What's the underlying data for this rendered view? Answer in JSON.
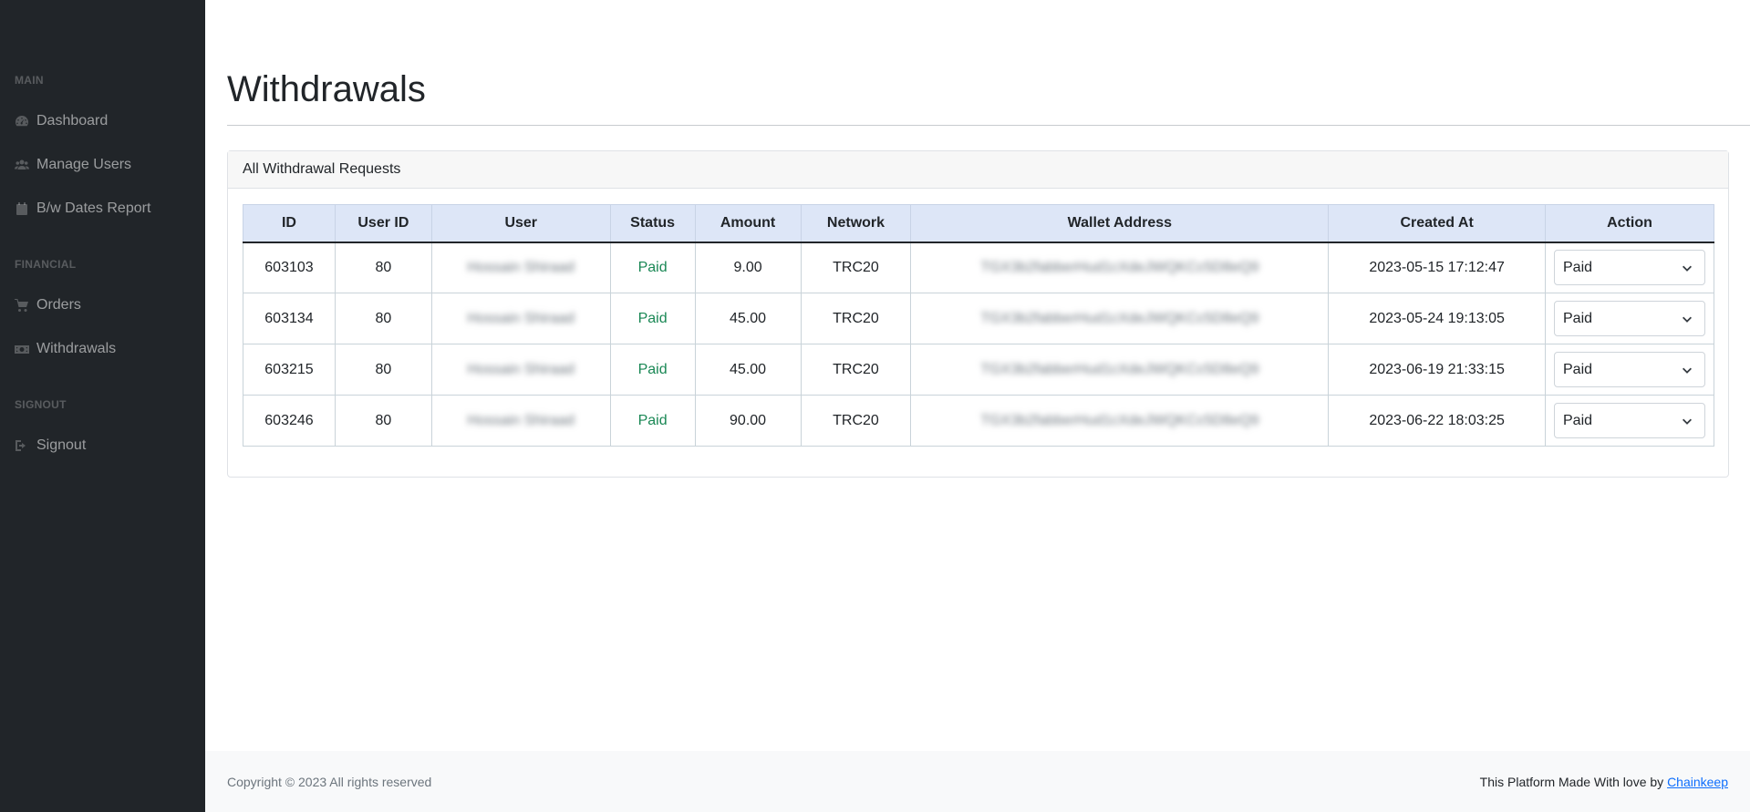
{
  "sidebar": {
    "headings": {
      "main": "MAIN",
      "financial": "FINANCIAL",
      "signout": "SIGNOUT"
    },
    "items": [
      {
        "label": "Dashboard",
        "icon": "tachometer-icon"
      },
      {
        "label": "Manage Users",
        "icon": "users-icon"
      },
      {
        "label": "B/w Dates Report",
        "icon": "calendar-icon"
      },
      {
        "label": "Orders",
        "icon": "cart-icon"
      },
      {
        "label": "Withdrawals",
        "icon": "money-icon"
      },
      {
        "label": "Signout",
        "icon": "sign-out-icon"
      }
    ]
  },
  "page": {
    "title": "Withdrawals"
  },
  "card": {
    "header": "All Withdrawal Requests"
  },
  "table": {
    "columns": [
      "ID",
      "User ID",
      "User",
      "Status",
      "Amount",
      "Network",
      "Wallet Address",
      "Created At",
      "Action"
    ],
    "rows": [
      {
        "id": "603103",
        "user_id": "80",
        "user": "Hossain Shiraad",
        "status": "Paid",
        "amount": "9.00",
        "network": "TRC20",
        "wallet": "TGX3b2fabberHud1cXdeJWQKCc5D8eQ9",
        "created_at": "2023-05-15 17:12:47",
        "action": "Paid"
      },
      {
        "id": "603134",
        "user_id": "80",
        "user": "Hossain Shiraad",
        "status": "Paid",
        "amount": "45.00",
        "network": "TRC20",
        "wallet": "TGX3b2fabberHud1cXdeJWQKCc5D8eQ9",
        "created_at": "2023-05-24 19:13:05",
        "action": "Paid"
      },
      {
        "id": "603215",
        "user_id": "80",
        "user": "Hossain Shiraad",
        "status": "Paid",
        "amount": "45.00",
        "network": "TRC20",
        "wallet": "TGX3b2fabberHud1cXdeJWQKCc5D8eQ9",
        "created_at": "2023-06-19 21:33:15",
        "action": "Paid"
      },
      {
        "id": "603246",
        "user_id": "80",
        "user": "Hossain Shiraad",
        "status": "Paid",
        "amount": "90.00",
        "network": "TRC20",
        "wallet": "TGX3b2fabberHud1cXdeJWQKCc5D8eQ9",
        "created_at": "2023-06-22 18:03:25",
        "action": "Paid"
      }
    ]
  },
  "footer": {
    "copyright": "Copyright © 2023 All rights reserved",
    "made_with": "This Platform Made With love by ",
    "link_label": "Chainkeep"
  },
  "colors": {
    "sidebar_bg": "#212529",
    "table_header_bg": "#dde6f7",
    "status_paid": "#198754",
    "link": "#0d6efd"
  }
}
